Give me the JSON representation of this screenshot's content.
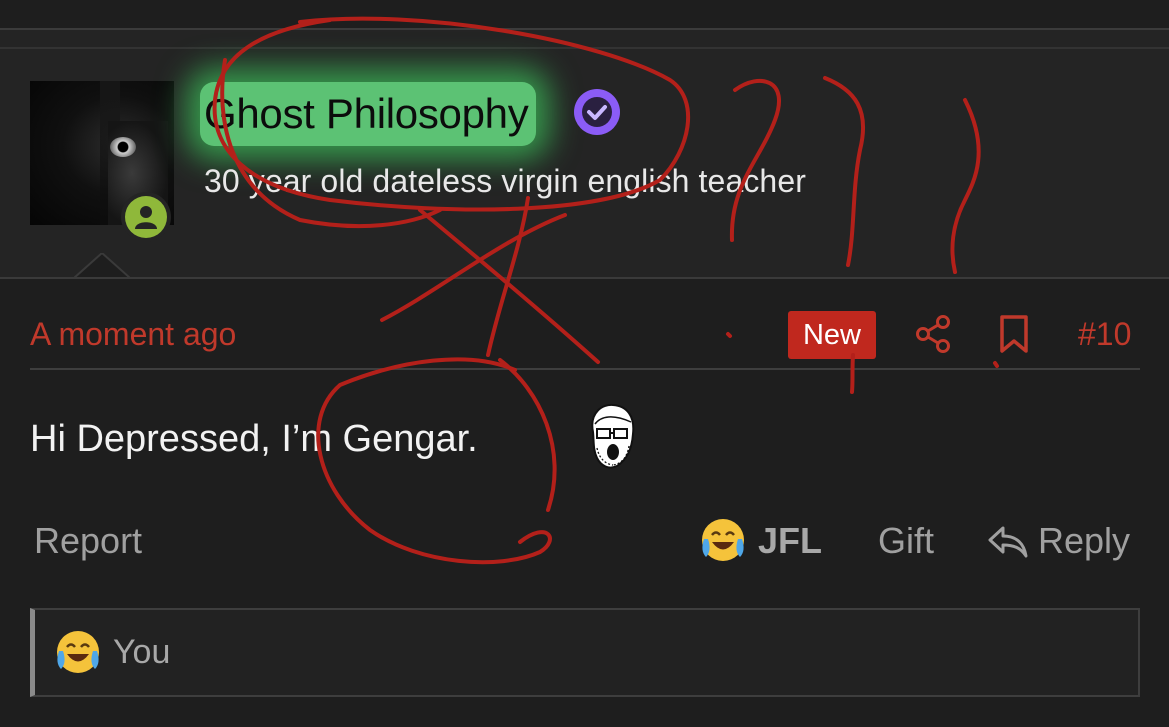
{
  "user": {
    "name": "Ghost Philosophy",
    "title": "30 year old dateless virgin english teacher",
    "verified": true,
    "online": true
  },
  "post": {
    "timestamp": "A moment ago",
    "badge": "New",
    "number": "#10",
    "body": "Hi Depressed, I’m Gengar."
  },
  "actions": {
    "report": "Report",
    "reaction": "JFL",
    "gift": "Gift",
    "reply": "Reply"
  },
  "reactions_bar": {
    "label": "You"
  },
  "colors": {
    "background": "#1e1e1e",
    "accent_red": "#c0392b",
    "username_glow": "#5cc274",
    "verified_purple": "#8b5cf6",
    "online_green": "#8fb83a"
  },
  "icons": [
    "verified-icon",
    "online-status-icon",
    "share-icon",
    "bookmark-icon",
    "soyjak-emoji",
    "laughing-crying-emoji",
    "reply-icon"
  ]
}
